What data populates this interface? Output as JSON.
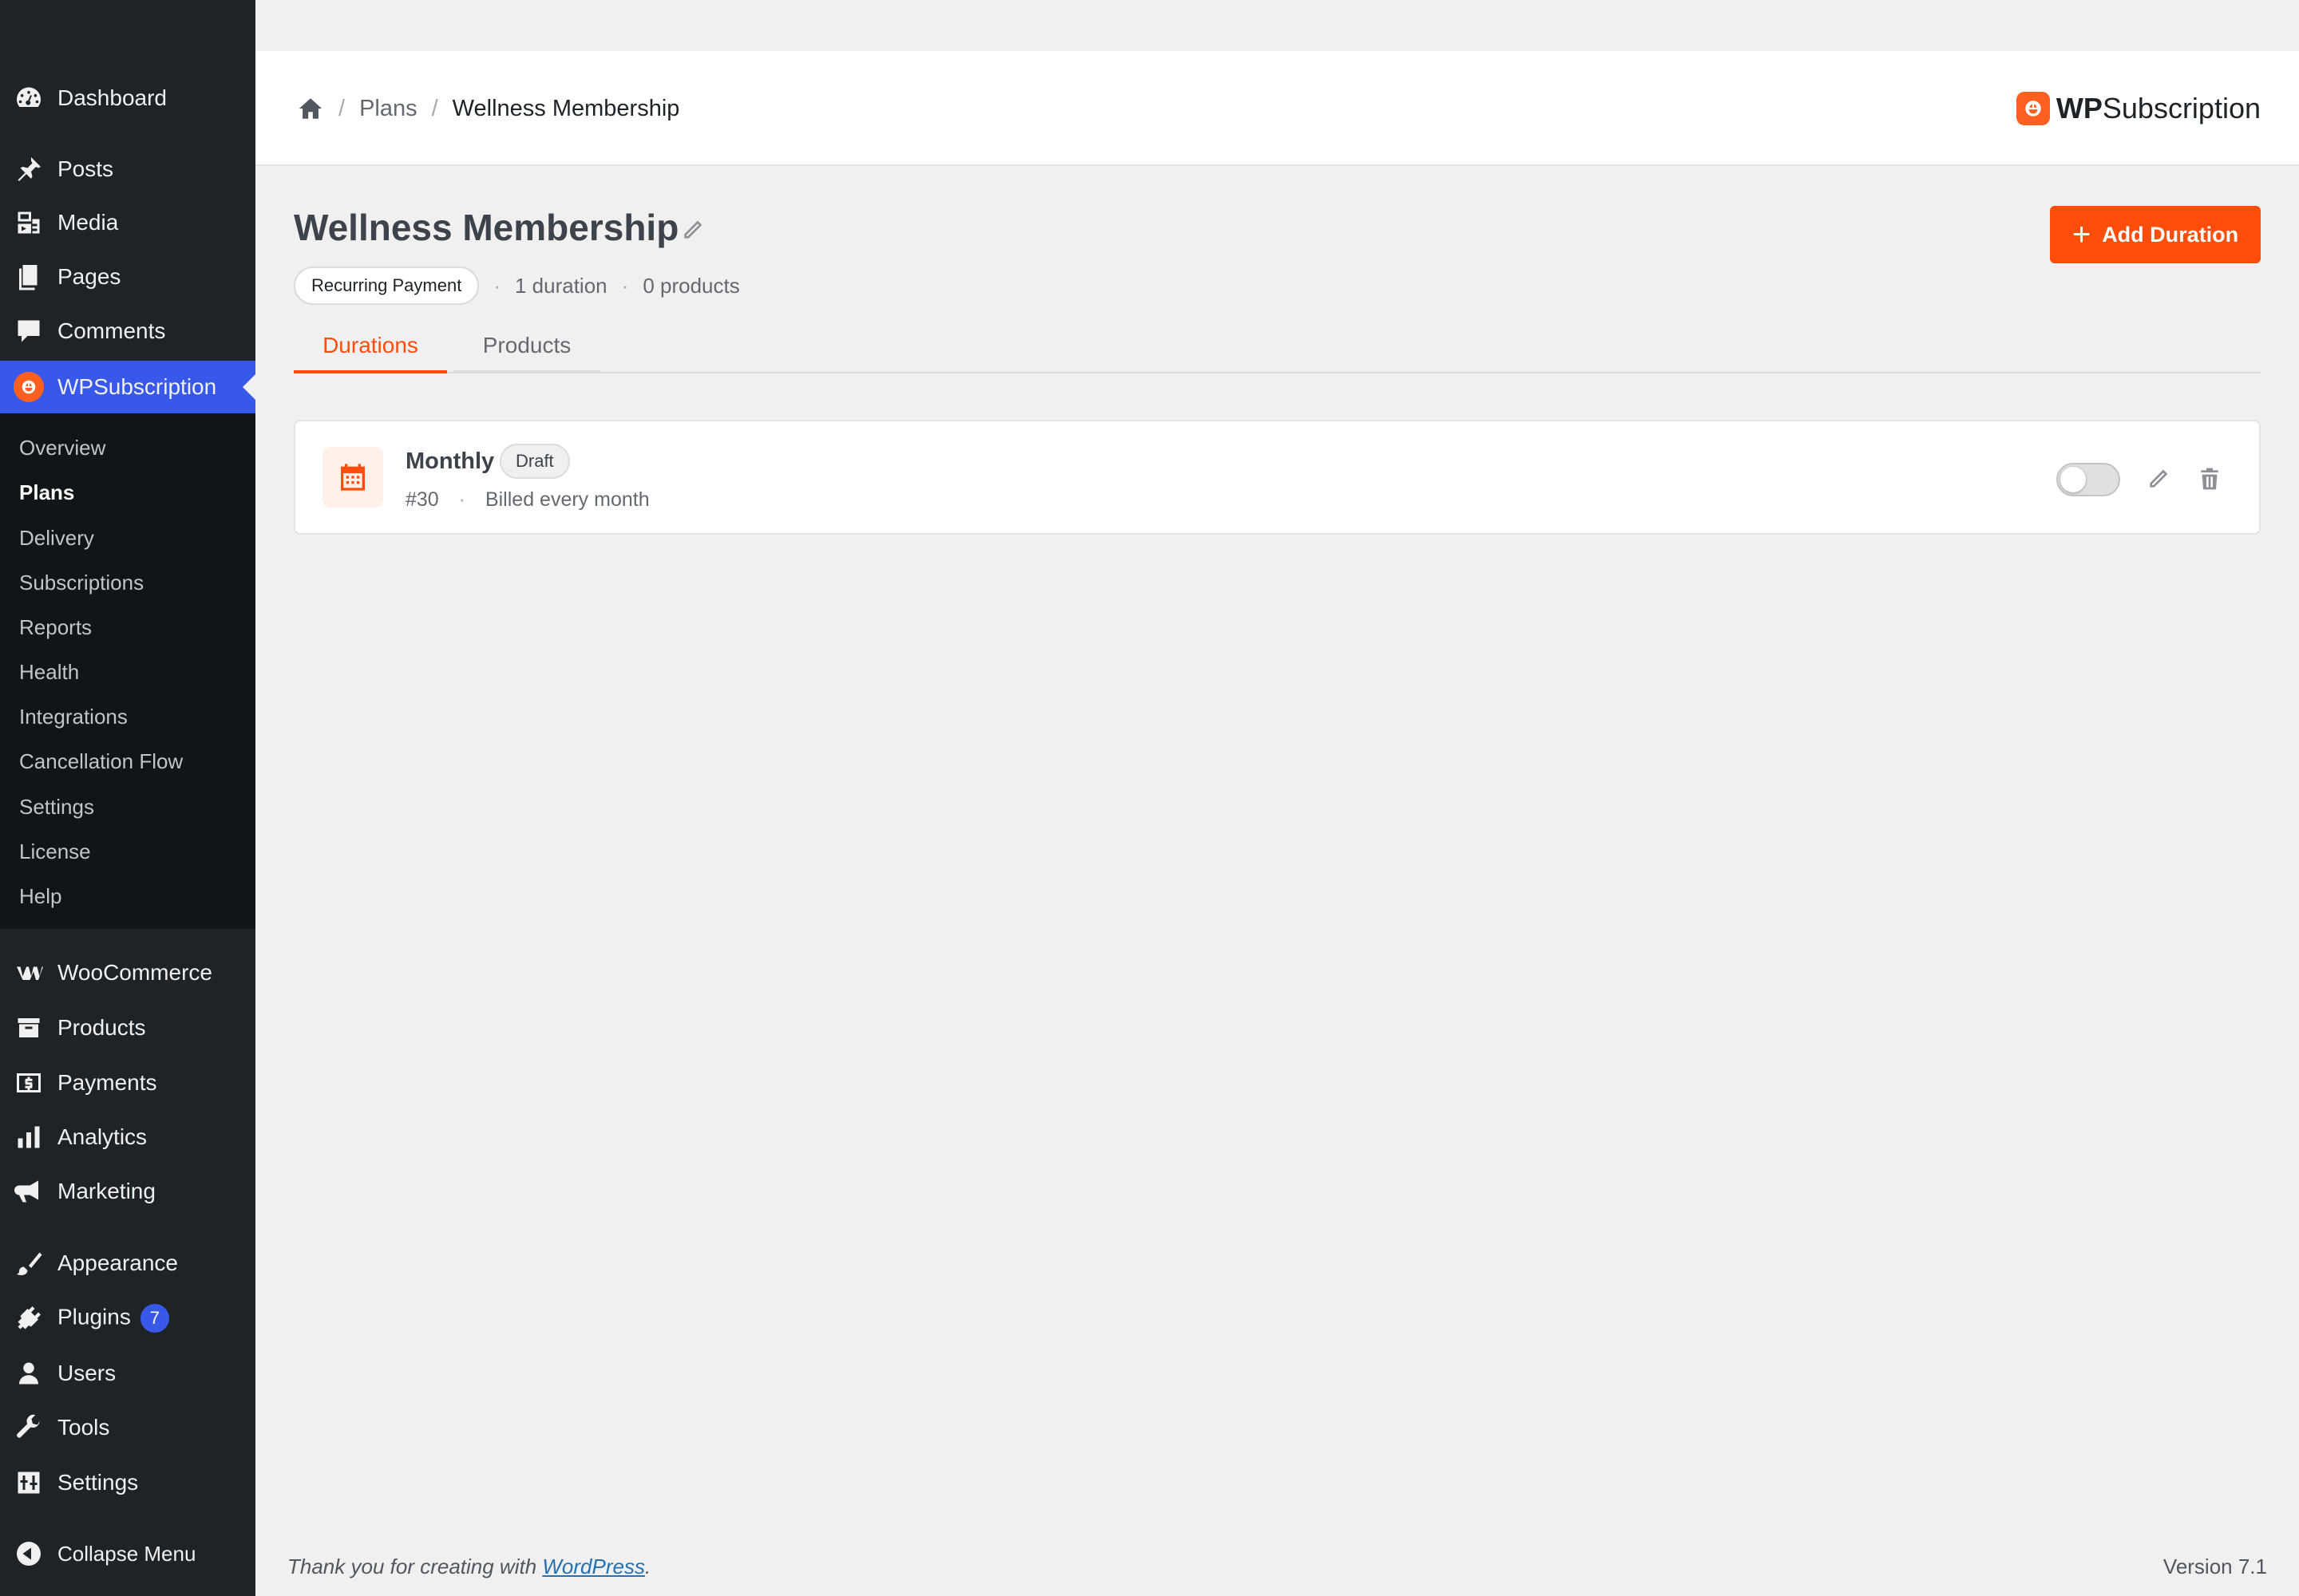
{
  "sidebar": {
    "menu": [
      {
        "label": "Dashboard",
        "icon": "dashboard-icon"
      },
      {
        "label": "Posts",
        "icon": "pushpin-icon"
      },
      {
        "label": "Media",
        "icon": "media-icon"
      },
      {
        "label": "Pages",
        "icon": "pages-icon"
      },
      {
        "label": "Comments",
        "icon": "comment-icon"
      },
      {
        "label": "WPSubscription",
        "icon": "wpsubscription-icon"
      },
      {
        "label": "WooCommerce",
        "icon": "woocommerce-icon"
      },
      {
        "label": "Products",
        "icon": "archive-icon"
      },
      {
        "label": "Payments",
        "icon": "dollar-icon"
      },
      {
        "label": "Analytics",
        "icon": "bar-chart-icon"
      },
      {
        "label": "Marketing",
        "icon": "megaphone-icon"
      },
      {
        "label": "Appearance",
        "icon": "paintbrush-icon"
      },
      {
        "label": "Plugins",
        "icon": "plug-icon",
        "badge": "7"
      },
      {
        "label": "Users",
        "icon": "user-icon"
      },
      {
        "label": "Tools",
        "icon": "wrench-icon"
      },
      {
        "label": "Settings",
        "icon": "sliders-icon"
      },
      {
        "label": "Collapse Menu",
        "icon": "collapse-icon"
      }
    ],
    "submenu": [
      "Overview",
      "Plans",
      "Delivery",
      "Subscriptions",
      "Reports",
      "Health",
      "Integrations",
      "Cancellation Flow",
      "Settings",
      "License",
      "Help"
    ],
    "accent_color": "#3858e9"
  },
  "header": {
    "breadcrumb": {
      "parent": "Plans",
      "current": "Wellness Membership",
      "separator": "/"
    },
    "brand_bold": "WP",
    "brand_rest": "Subscription",
    "brand_color": "#ff5f1f"
  },
  "plan": {
    "title": "Wellness Membership",
    "payment_type": "Recurring Payment",
    "duration_count": "1 duration",
    "product_count": "0 products",
    "meta_separator": "·",
    "add_button": "Add Duration",
    "accent_color": "#ff4d0b"
  },
  "tabs": [
    {
      "label": "Durations",
      "active": true
    },
    {
      "label": "Products",
      "active": false
    }
  ],
  "durations": [
    {
      "name": "Monthly",
      "status": "Draft",
      "id": "#30",
      "billing": "Billed every month",
      "enabled": false,
      "icon": "calendar-icon"
    }
  ],
  "footer": {
    "thanks_prefix": "Thank you for creating with ",
    "thanks_link": "WordPress",
    "thanks_suffix": ".",
    "version": "Version 7.1"
  }
}
